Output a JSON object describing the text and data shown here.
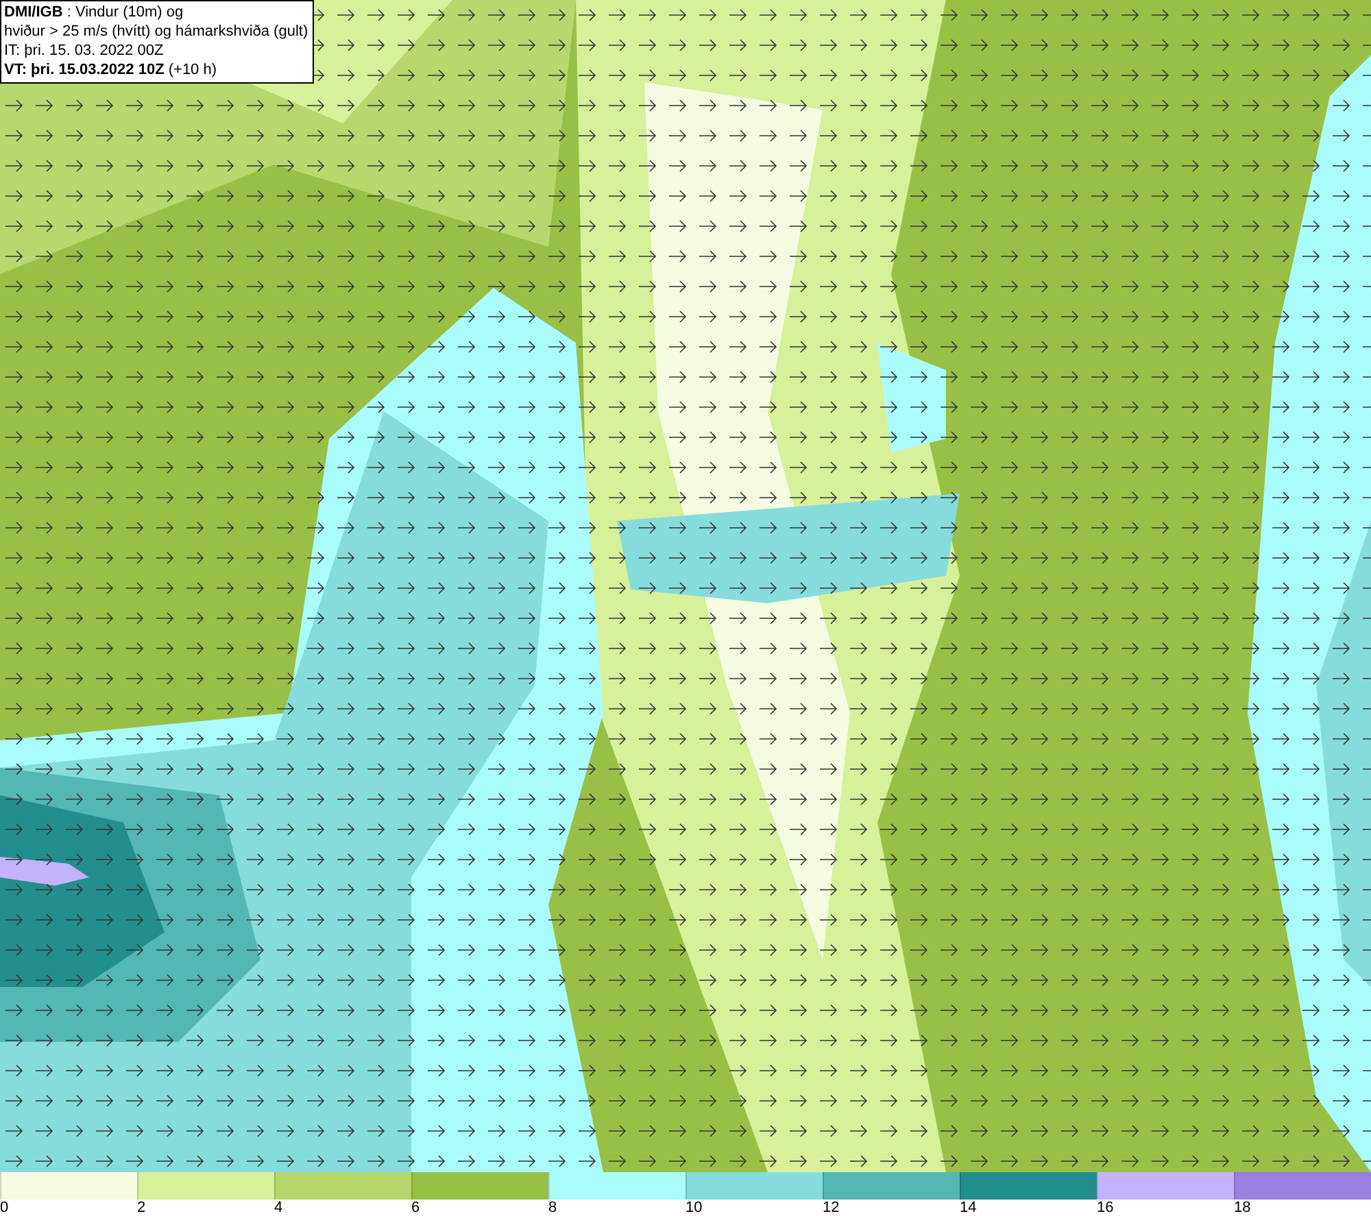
{
  "header": {
    "lines": [
      "**DMI/IGB** : Vindur (10m) og",
      "hviður > 25 m/s (hvítt) og hámarkshviða (gult)",
      "IT: þri. 15. 03. 2022 00Z",
      "**VT: þri. 15.03.2022 10Z** (+10 h)"
    ]
  },
  "legend": [
    {
      "label": "0",
      "color": "#f4fbe0"
    },
    {
      "label": "2",
      "color": "#d7f09a"
    },
    {
      "label": "4",
      "color": "#b6d86f"
    },
    {
      "label": "6",
      "color": "#98c046"
    },
    {
      "label": "8",
      "color": "#aafcfc"
    },
    {
      "label": "10",
      "color": "#86dcdc"
    },
    {
      "label": "12",
      "color": "#55b6b6"
    },
    {
      "label": "14",
      "color": "#238e8e"
    },
    {
      "label": "16",
      "color": "#c3b3fb"
    },
    {
      "label": "18",
      "color": "#9a80e0"
    }
  ]
}
